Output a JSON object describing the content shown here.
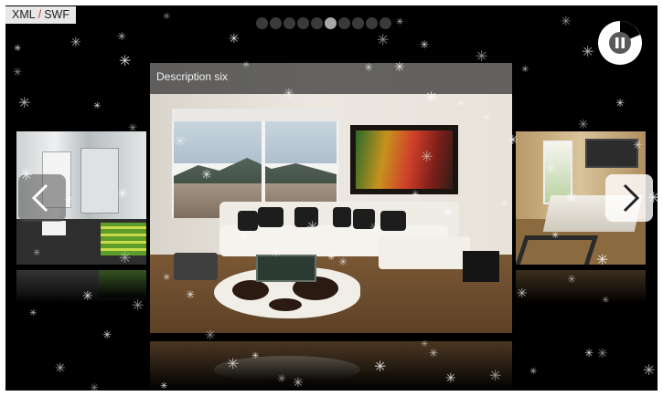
{
  "toggle": {
    "xml": "XML",
    "separator": "/",
    "swf": "SWF"
  },
  "pagination": {
    "count": 10,
    "active_index": 5
  },
  "slides": {
    "current": {
      "caption": "Description six"
    }
  },
  "controls": {
    "pause_icon": "pause-icon",
    "prev_icon": "chevron-left-icon",
    "next_icon": "chevron-right-icon"
  },
  "colors": {
    "background": "#000000",
    "dot_inactive": "#3a3a3a",
    "dot_active": "#a8a8a8",
    "caption_bar": "#3c3c3c"
  }
}
